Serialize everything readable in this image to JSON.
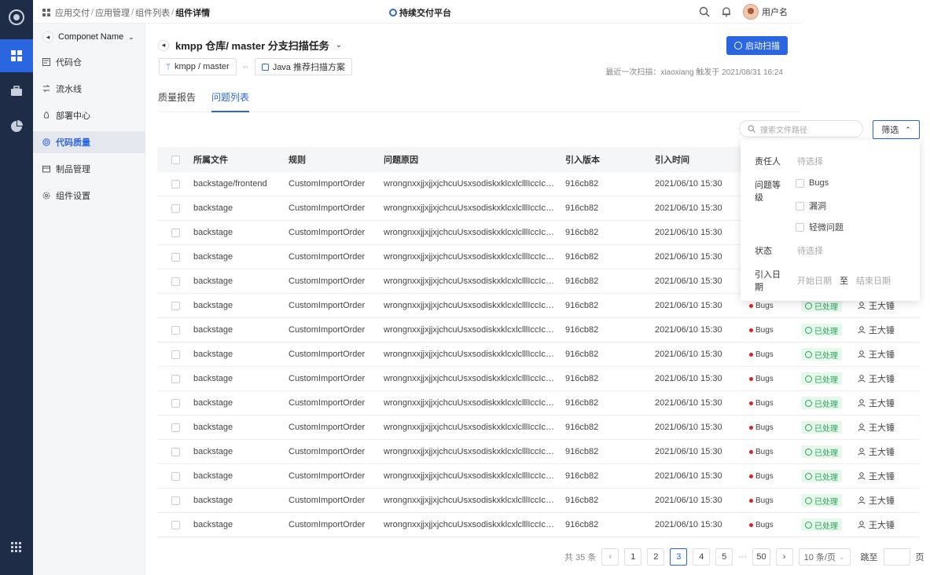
{
  "breadcrumb": [
    "应用交付",
    "应用管理",
    "组件列表",
    "组件详情"
  ],
  "platform": "持续交付平台",
  "user": {
    "name": "用户名"
  },
  "sidebar": {
    "component_name": "Componet  Name",
    "items": [
      {
        "label": "代码仓",
        "icon": "repo-icon"
      },
      {
        "label": "流水线",
        "icon": "pipeline-icon"
      },
      {
        "label": "部署中心",
        "icon": "deploy-icon"
      },
      {
        "label": "代码质量",
        "icon": "quality-icon"
      },
      {
        "label": "制品管理",
        "icon": "artifact-icon"
      },
      {
        "label": "组件设置",
        "icon": "settings-icon"
      }
    ]
  },
  "header": {
    "title": "kmpp 仓库/ master 分支扫描任务",
    "start_button": "启动扫描",
    "branch_chip": "kmpp / master",
    "scheme_chip": "Java 推荐扫描方案",
    "last_scan": "最近一次扫描：xiaoxiang 触发于 2021/08/31 16:24"
  },
  "tabs": [
    "质量报告",
    "问题列表"
  ],
  "search": {
    "placeholder": "搜索文件路径"
  },
  "filter": {
    "button": "筛选",
    "assignee_label": "责任人",
    "assignee_placeholder": "待选择",
    "level_label": "问题等级",
    "levels": [
      "Bugs",
      "漏洞",
      "轻微问题"
    ],
    "status_label": "状态",
    "status_placeholder": "待选择",
    "date_label": "引入日期",
    "date_start": "开始日期",
    "date_to": "至",
    "date_end": "结束日期"
  },
  "table": {
    "columns": [
      "所属文件",
      "规则",
      "问题原因",
      "引入版本",
      "引入时间"
    ],
    "rows": [
      {
        "file": "backstage/frontend",
        "rule": "CustomImportOrder",
        "reason": "wrongnxxjjxjjxjchcuUsxsodiskxklcxlclllIccIclccl",
        "version": "916cb82",
        "time": "2021/06/10 15:30",
        "level": "",
        "status": "",
        "owner": ""
      },
      {
        "file": "backstage",
        "rule": "CustomImportOrder",
        "reason": "wrongnxxjjxjjxjchcuUsxsodiskxklcxlclllIccIclccl",
        "version": "916cb82",
        "time": "2021/06/10 15:30",
        "level": "",
        "status": "",
        "owner": ""
      },
      {
        "file": "backstage",
        "rule": "CustomImportOrder",
        "reason": "wrongnxxjjxjjxjchcuUsxsodiskxklcxlclllIccIclccl",
        "version": "916cb82",
        "time": "2021/06/10 15:30",
        "level": "",
        "status": "",
        "owner": ""
      },
      {
        "file": "backstage",
        "rule": "CustomImportOrder",
        "reason": "wrongnxxjjxjjxjchcuUsxsodiskxklcxlclllIccIclccl",
        "version": "916cb82",
        "time": "2021/06/10 15:30",
        "level": "",
        "status": "",
        "owner": ""
      },
      {
        "file": "backstage",
        "rule": "CustomImportOrder",
        "reason": "wrongnxxjjxjjxjchcuUsxsodiskxklcxlclllIccIclccl",
        "version": "916cb82",
        "time": "2021/06/10 15:30",
        "level": "",
        "status": "",
        "owner": ""
      },
      {
        "file": "backstage",
        "rule": "CustomImportOrder",
        "reason": "wrongnxxjjxjjxjchcuUsxsodiskxklcxlclllIccIclccl",
        "version": "916cb82",
        "time": "2021/06/10 15:30",
        "level": "Bugs",
        "status": "已处理",
        "owner": "王大锤"
      },
      {
        "file": "backstage",
        "rule": "CustomImportOrder",
        "reason": "wrongnxxjjxjjxjchcuUsxsodiskxklcxlclllIccIclccl",
        "version": "916cb82",
        "time": "2021/06/10 15:30",
        "level": "Bugs",
        "status": "已处理",
        "owner": "王大锤"
      },
      {
        "file": "backstage",
        "rule": "CustomImportOrder",
        "reason": "wrongnxxjjxjjxjchcuUsxsodiskxklcxlclllIccIclccl",
        "version": "916cb82",
        "time": "2021/06/10 15:30",
        "level": "Bugs",
        "status": "已处理",
        "owner": "王大锤"
      },
      {
        "file": "backstage",
        "rule": "CustomImportOrder",
        "reason": "wrongnxxjjxjjxjchcuUsxsodiskxklcxlclllIccIclccl",
        "version": "916cb82",
        "time": "2021/06/10 15:30",
        "level": "Bugs",
        "status": "已处理",
        "owner": "王大锤"
      },
      {
        "file": "backstage",
        "rule": "CustomImportOrder",
        "reason": "wrongnxxjjxjjxjchcuUsxsodiskxklcxlclllIccIclccl",
        "version": "916cb82",
        "time": "2021/06/10 15:30",
        "level": "Bugs",
        "status": "已处理",
        "owner": "王大锤"
      },
      {
        "file": "backstage",
        "rule": "CustomImportOrder",
        "reason": "wrongnxxjjxjjxjchcuUsxsodiskxklcxlclllIccIclccl",
        "version": "916cb82",
        "time": "2021/06/10 15:30",
        "level": "Bugs",
        "status": "已处理",
        "owner": "王大锤"
      },
      {
        "file": "backstage",
        "rule": "CustomImportOrder",
        "reason": "wrongnxxjjxjjxjchcuUsxsodiskxklcxlclllIccIclccl",
        "version": "916cb82",
        "time": "2021/06/10 15:30",
        "level": "Bugs",
        "status": "已处理",
        "owner": "王大锤"
      },
      {
        "file": "backstage",
        "rule": "CustomImportOrder",
        "reason": "wrongnxxjjxjjxjchcuUsxsodiskxklcxlclllIccIclccl",
        "version": "916cb82",
        "time": "2021/06/10 15:30",
        "level": "Bugs",
        "status": "已处理",
        "owner": "王大锤"
      },
      {
        "file": "backstage",
        "rule": "CustomImportOrder",
        "reason": "wrongnxxjjxjjxjchcuUsxsodiskxklcxlclllIccIclccl",
        "version": "916cb82",
        "time": "2021/06/10 15:30",
        "level": "Bugs",
        "status": "已处理",
        "owner": "王大锤"
      },
      {
        "file": "backstage",
        "rule": "CustomImportOrder",
        "reason": "wrongnxxjjxjjxjchcuUsxsodiskxklcxlclllIccIclccl",
        "version": "916cb82",
        "time": "2021/06/10 15:30",
        "level": "Bugs",
        "status": "已处理",
        "owner": "王大锤"
      }
    ]
  },
  "pagination": {
    "total": "共 35 条",
    "pages": [
      "1",
      "2",
      "3",
      "4",
      "5"
    ],
    "current": "3",
    "ellipsis": "···",
    "last": "50",
    "page_size": "10 条/页",
    "jump_label": "跳至",
    "page_unit": "页"
  },
  "colors": {
    "primary": "#2a66e0",
    "rail": "#1f2c48",
    "bug": "#e02020",
    "done": "#2aa35a"
  }
}
